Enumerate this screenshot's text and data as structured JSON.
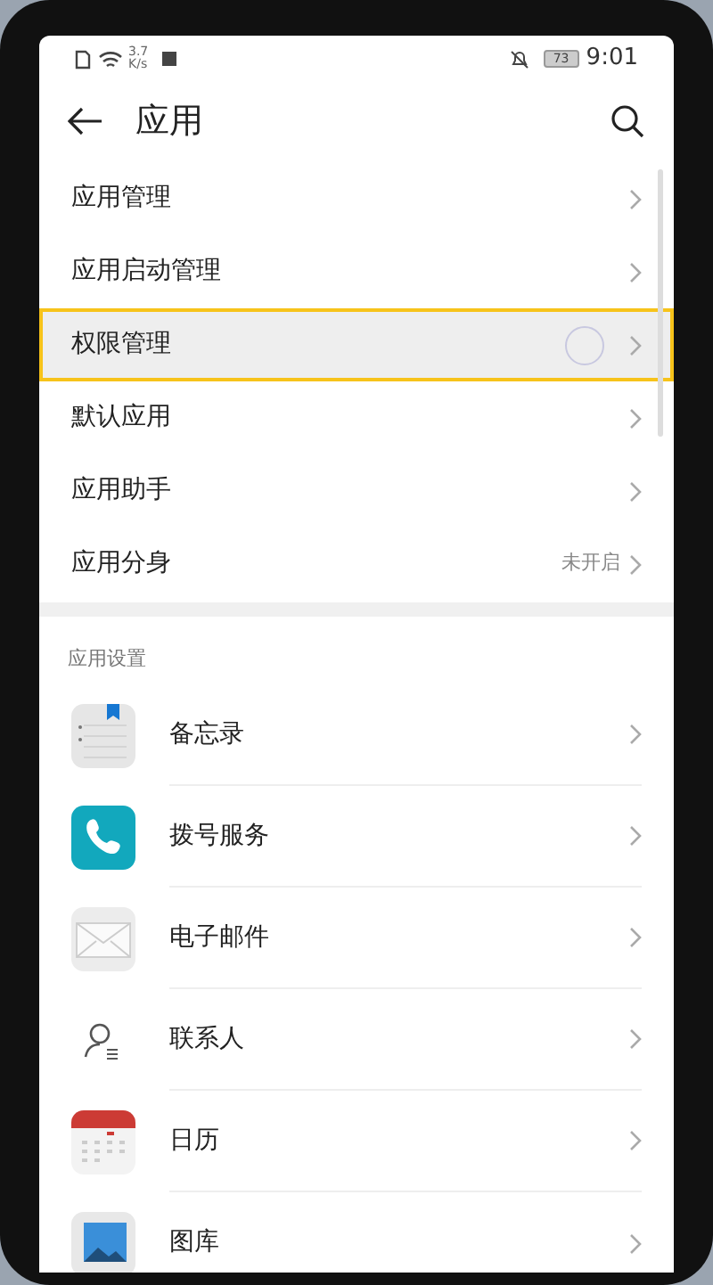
{
  "status_bar": {
    "net_speed": "3.7",
    "net_unit": "K/s",
    "battery": "73",
    "time": "9:01"
  },
  "header": {
    "title": "应用"
  },
  "menu": [
    {
      "label": "应用管理",
      "selected": false
    },
    {
      "label": "应用启动管理",
      "selected": false
    },
    {
      "label": "权限管理",
      "selected": true
    },
    {
      "label": "默认应用",
      "selected": false
    },
    {
      "label": "应用助手",
      "selected": false
    },
    {
      "label": "应用分身",
      "selected": false,
      "value": "未开启"
    }
  ],
  "section": {
    "title": "应用设置"
  },
  "apps": [
    {
      "label": "备忘录",
      "kind": "notes"
    },
    {
      "label": "拨号服务",
      "kind": "phone"
    },
    {
      "label": "电子邮件",
      "kind": "mail"
    },
    {
      "label": "联系人",
      "kind": "contacts"
    },
    {
      "label": "日历",
      "kind": "calendar"
    },
    {
      "label": "图库",
      "kind": "gallery"
    }
  ]
}
